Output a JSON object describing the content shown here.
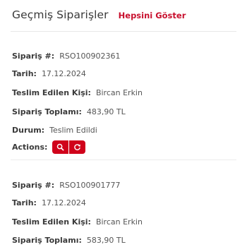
{
  "header": {
    "title": "Geçmiş Siparişler",
    "show_all": "Hepsini Göster"
  },
  "labels": {
    "order_no": "Sipariş #:",
    "date": "Tarih:",
    "recipient": "Teslim Edilen Kişi:",
    "total": "Sipariş Toplamı:",
    "status": "Durum:",
    "actions": "Actions:"
  },
  "orders": [
    {
      "order_no": "RSO100902361",
      "date": "17.12.2024",
      "recipient": "Bircan Erkin",
      "total": "483,90 TL",
      "status": "Teslim Edildi"
    },
    {
      "order_no": "RSO100901777",
      "date": "17.12.2024",
      "recipient": "Bircan Erkin",
      "total": "583,90 TL"
    }
  ],
  "icons": {
    "view": "search-icon",
    "reorder": "refresh-icon"
  },
  "colors": {
    "accent": "#d0021b",
    "link": "#c8102e"
  }
}
